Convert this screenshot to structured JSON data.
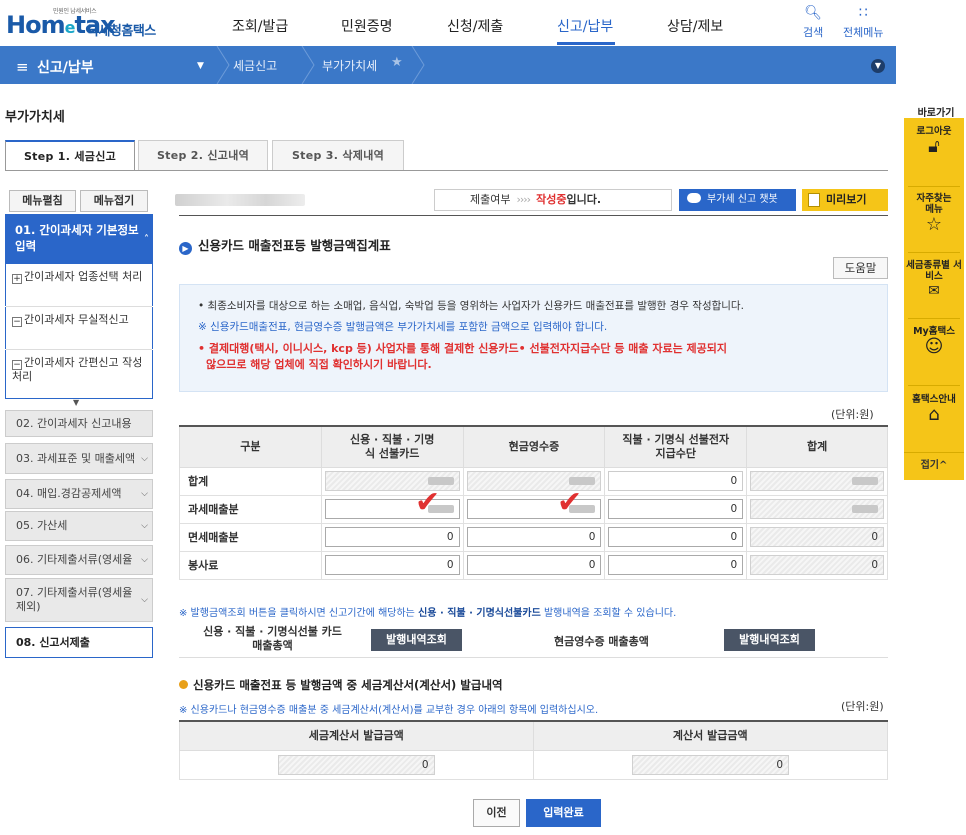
{
  "header": {
    "logo_small": "민원인 납세서비스",
    "logo_main_a": "Hom",
    "logo_main_e": "e",
    "logo_main_b": "tax",
    "logo_sub": "국세청홈택스",
    "nav": [
      "조회/발급",
      "민원증명",
      "신청/제출",
      "신고/납부",
      "상담/제보"
    ],
    "search_label": "검색",
    "allmenu_label": "전체메뉴"
  },
  "locbar": {
    "menu_title": "신고/납부",
    "crumbs": [
      "세금신고",
      "부가가치세"
    ]
  },
  "page_title": "부가가치세",
  "tabs": [
    "Step 1. 세금신고",
    "Step 2. 신고내역",
    "Step 3. 삭제내역"
  ],
  "sidebar": {
    "expand_all": "메뉴펼침",
    "collapse_all": "메뉴접기",
    "active_item": "01. 간이과세자 기본정보 입력",
    "sub_items": [
      {
        "icon": "+",
        "label": "간이과세자 업종선택 처리"
      },
      {
        "icon": "−",
        "label": "간이과세자 무실적신고"
      },
      {
        "icon": "−",
        "label": "간이과세자 간편신고 작성 처리"
      }
    ],
    "items": [
      "02. 간이과세자 신고내용",
      "03. 과세표준 및 매출세액",
      "04. 매입.경감공제세액",
      "05. 가산세",
      "06. 기타제출서류(영세율",
      "07. 기타제출서류(영세율 제외)",
      "08. 신고서제출"
    ]
  },
  "status": {
    "label": "제출여부",
    "arrows": "››››",
    "value_red": "작성중",
    "value_suffix": "입니다."
  },
  "buttons": {
    "chatbot": "부가세 신고 챗봇",
    "preview": "미리보기",
    "help": "도움말",
    "prev": "이전",
    "done": "입력완료",
    "lookup1": "발행내역조회",
    "lookup2": "발행내역조회"
  },
  "section1": {
    "title": "신용카드 매출전표등 발행금액집계표",
    "info1": "• 최종소비자를 대상으로 하는 소매업, 음식업, 숙박업 등을 영위하는 사업자가 신용카드 매출전표를 발행한 경우 작성합니다.",
    "info2": "※ 신용카드매출전표, 현금영수증 발행금액은 부가가치세를 포함한 금액으로 입력해야 합니다.",
    "info3a": "• 결제대행(택시, 이니시스, kcp 등) 사업자를 통해 결제한 신용카드• 선불전자지급수단 등 매출 자료는 제공되지",
    "info3b": "않으므로 해당 업체에 직접 확인하시기 바랍니다.",
    "unit": "(단위:원)",
    "columns": [
      "구분",
      "신용 · 직불 · 기명식 선불카드",
      "현금영수증",
      "직불 · 기명식 선불전자지급수단",
      "합계"
    ],
    "rows": [
      {
        "label": "합계",
        "cells": [
          "",
          "",
          "0",
          ""
        ]
      },
      {
        "label": "과세매출분",
        "cells": [
          "",
          "",
          "0",
          ""
        ]
      },
      {
        "label": "면세매출분",
        "cells": [
          "0",
          "0",
          "0",
          "0"
        ]
      },
      {
        "label": "봉사료",
        "cells": [
          "0",
          "0",
          "0",
          "0"
        ]
      }
    ],
    "note_a": "※ 발행금액조회 버튼을 클릭하시면 신고기간에 해당하는 ",
    "note_b": "신용 · 직불 · 기명식선불카드",
    "note_c": " 발행내역을 조회할 수 있습니다.",
    "lookup_label1": "신용 · 직불 · 기명식선불 카드 매출총액",
    "lookup_label2": "현금영수증 매출총액"
  },
  "section2": {
    "title": "신용카드 매출전표 등 발행금액 중 세금계산서(계산서) 발급내역",
    "note": "※ 신용카드나 현금영수증 매출분 중 세금계산서(계산서)를 교부한 경우 아래의 항목에 입력하십시오.",
    "unit": "(단위:원)",
    "columns": [
      "세금계산서 발급금액",
      "계산서 발급금액"
    ],
    "values": [
      "0",
      "0"
    ]
  },
  "quick": {
    "title": "바로가기",
    "items": [
      "로그아웃",
      "자주찾는 메뉴",
      "세금종류별 서비스",
      "My홈택스",
      "홈택스안내"
    ],
    "close": "접기^"
  },
  "colors": {
    "primary": "#2a66c9",
    "locbar": "#3b78c8",
    "accent": "#f5c518",
    "alert": "#e03030"
  }
}
